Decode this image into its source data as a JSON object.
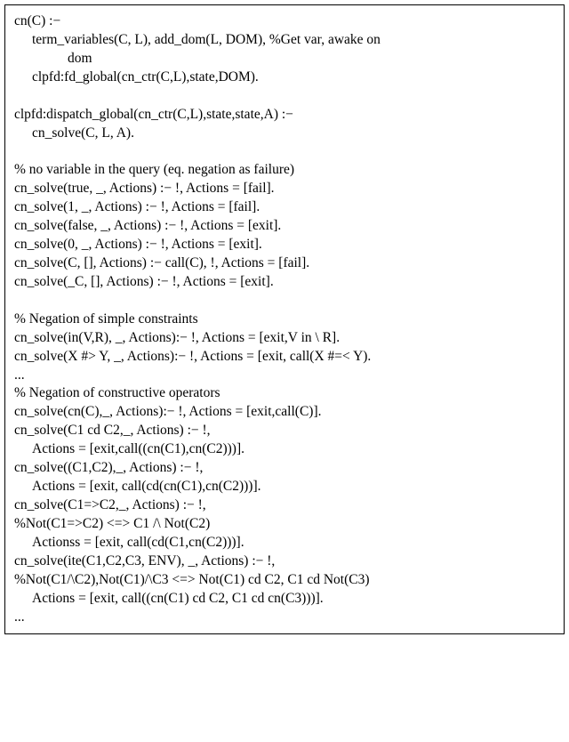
{
  "lines": [
    {
      "cls": "",
      "text": "cn(C) :−"
    },
    {
      "cls": "indent1",
      "text": "term_variables(C, L), add_dom(L, DOM), %Get var, awake on"
    },
    {
      "cls": "indent2",
      "text": "dom"
    },
    {
      "cls": "indent1",
      "text": "clpfd:fd_global(cn_ctr(C,L),state,DOM)."
    },
    {
      "cls": "",
      "text": ""
    },
    {
      "cls": "",
      "text": "clpfd:dispatch_global(cn_ctr(C,L),state,state,A) :−"
    },
    {
      "cls": "indent1",
      "text": "cn_solve(C, L, A)."
    },
    {
      "cls": "",
      "text": ""
    },
    {
      "cls": "",
      "text": "% no variable in the query (eq. negation as failure)"
    },
    {
      "cls": "",
      "text": "cn_solve(true, _, Actions) :− !, Actions = [fail]."
    },
    {
      "cls": "",
      "text": "cn_solve(1, _, Actions) :− !, Actions = [fail]."
    },
    {
      "cls": "",
      "text": "cn_solve(false, _, Actions) :− !, Actions = [exit]."
    },
    {
      "cls": "",
      "text": "cn_solve(0, _, Actions) :− !, Actions = [exit]."
    },
    {
      "cls": "",
      "text": "cn_solve(C, [], Actions) :− call(C), !, Actions = [fail]."
    },
    {
      "cls": "",
      "text": "cn_solve(_C, [], Actions) :− !, Actions = [exit]."
    },
    {
      "cls": "",
      "text": ""
    },
    {
      "cls": "",
      "text": "% Negation of simple constraints"
    },
    {
      "cls": "",
      "text": "cn_solve(in(V,R), _, Actions):− !, Actions = [exit,V in \\ R]."
    },
    {
      "cls": "",
      "text": "cn_solve(X #> Y, _, Actions):− !, Actions = [exit, call(X #=< Y)."
    },
    {
      "cls": "",
      "text": "..."
    },
    {
      "cls": "",
      "text": "% Negation of constructive operators"
    },
    {
      "cls": "",
      "text": "cn_solve(cn(C),_, Actions):− !, Actions = [exit,call(C)]."
    },
    {
      "cls": "",
      "text": "cn_solve(C1 cd C2,_, Actions) :− !,"
    },
    {
      "cls": "indent1",
      "text": "Actions = [exit,call((cn(C1),cn(C2)))]."
    },
    {
      "cls": "",
      "text": "cn_solve((C1,C2),_, Actions) :− !,"
    },
    {
      "cls": "indent1",
      "text": "Actions = [exit, call(cd(cn(C1),cn(C2)))]."
    },
    {
      "cls": "",
      "text": "cn_solve(C1=>C2,_, Actions) :− !,"
    },
    {
      "cls": "",
      "text": "%Not(C1=>C2) <=> C1 /\\ Not(C2)"
    },
    {
      "cls": "indent1",
      "text": "Actionss = [exit, call(cd(C1,cn(C2)))]."
    },
    {
      "cls": "",
      "text": "cn_solve(ite(C1,C2,C3, ENV), _, Actions) :− !,"
    },
    {
      "cls": "",
      "text": "%Not(C1/\\C2),Not(C1)/\\C3 <=> Not(C1) cd C2, C1 cd Not(C3)"
    },
    {
      "cls": "indent1",
      "text": "Actions = [exit, call((cn(C1) cd C2, C1 cd cn(C3)))]."
    },
    {
      "cls": "",
      "text": "..."
    }
  ]
}
